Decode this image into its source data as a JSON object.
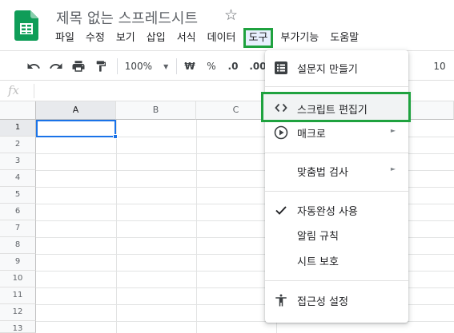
{
  "app": {
    "doc_title": "제목 없는 스프레드시트"
  },
  "menubar": {
    "items": [
      "파일",
      "수정",
      "보기",
      "삽입",
      "서식",
      "데이터",
      "도구",
      "부가기능",
      "도움말"
    ],
    "active": "도구"
  },
  "toolbar": {
    "zoom": "100%",
    "currency": "₩",
    "percent": "%",
    "dec_decrease": ".0",
    "dec_increase": ".00",
    "font_size": "10"
  },
  "formula_bar": {
    "fx_label": "fx",
    "value": ""
  },
  "grid": {
    "columns": [
      "A",
      "B",
      "C"
    ],
    "rows": [
      "1",
      "2",
      "3",
      "4",
      "5",
      "6",
      "7",
      "8",
      "9",
      "10",
      "11",
      "12",
      "13"
    ],
    "selected_cell": "A1"
  },
  "tools_menu": {
    "items": [
      {
        "label": "설문지 만들기",
        "icon": "form-icon"
      },
      {
        "label": "스크립트 편집기",
        "icon": "code-icon"
      },
      {
        "label": "매크로",
        "icon": "play-circle-icon",
        "submenu": true
      },
      {
        "label": "맞춤법 검사",
        "submenu": true
      },
      {
        "label": "자동완성 사용",
        "icon": "check-icon",
        "checked": true
      },
      {
        "label": "알림 규칙"
      },
      {
        "label": "시트 보호"
      },
      {
        "label": "접근성 설정",
        "icon": "accessibility-icon"
      }
    ],
    "highlighted": "스크립트 편집기"
  },
  "colors": {
    "sheets_green": "#0f9d58",
    "annotation_green": "#1fa23f",
    "selection_blue": "#1a73e8"
  }
}
